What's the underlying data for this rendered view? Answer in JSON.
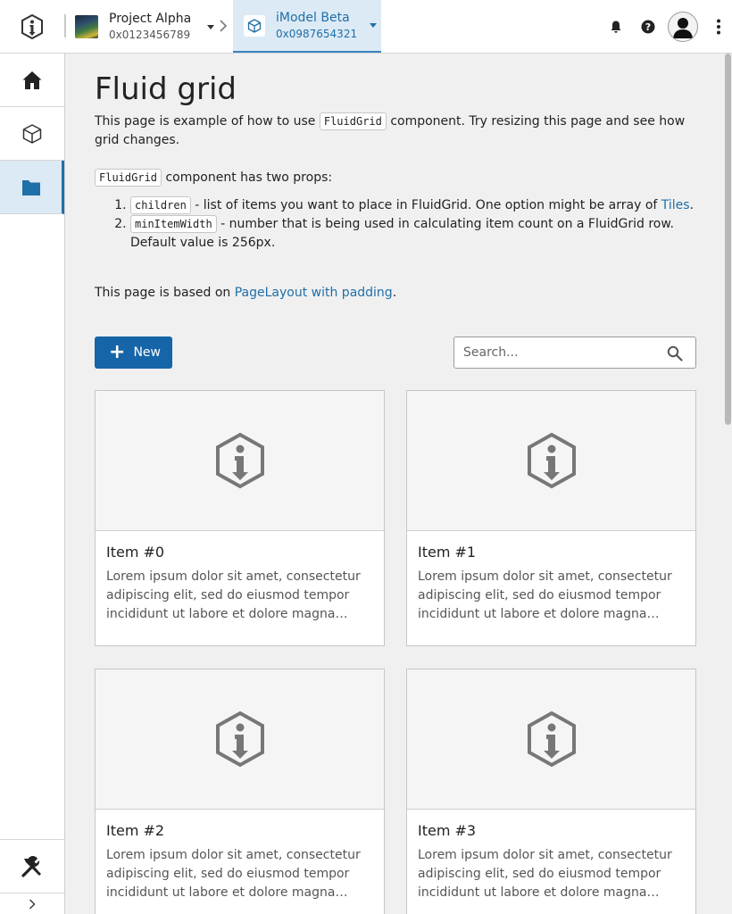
{
  "header": {
    "project": {
      "title": "Project Alpha",
      "id": "0x0123456789"
    },
    "imodel": {
      "title": "iModel Beta",
      "id": "0x0987654321"
    },
    "icons": [
      "app-logo-icon",
      "bell-icon",
      "help-icon",
      "user-avatar-icon",
      "more-vertical-icon"
    ]
  },
  "sidebar": {
    "items": [
      {
        "name": "home",
        "icon": "home-icon"
      },
      {
        "name": "imodel",
        "icon": "cube-icon"
      },
      {
        "name": "folder",
        "icon": "folder-icon",
        "active": true
      }
    ],
    "bottom": {
      "name": "tools",
      "icon": "tools-icon"
    }
  },
  "page": {
    "title": "Fluid grid",
    "intro_prefix": "This page is example of how to use",
    "intro_code": "FluidGrid",
    "intro_suffix": "component. Try resizing this page and see how grid changes.",
    "props_code": "FluidGrid",
    "props_text": "component has two props:",
    "prop1_code": "children",
    "prop1_text": "- list of items you want to place in FluidGrid. One option might be array of",
    "prop1_link": "Tiles",
    "prop1_end": ".",
    "prop2_code": "minItemWidth",
    "prop2_text": "- number that is being used in calculating item count on a FluidGrid row. Default value is 256px.",
    "based_prefix": "This page is based on",
    "based_link": "PageLayout with padding",
    "based_end": "."
  },
  "toolbar": {
    "new_label": "New",
    "search_placeholder": "Search..."
  },
  "tiles": [
    {
      "name": "Item #0",
      "description": "Lorem ipsum dolor sit amet, consectetur adipiscing elit, sed do eiusmod tempor incididunt ut labore et dolore magna aliqua."
    },
    {
      "name": "Item #1",
      "description": "Lorem ipsum dolor sit amet, consectetur adipiscing elit, sed do eiusmod tempor incididunt ut labore et dolore magna aliqua."
    },
    {
      "name": "Item #2",
      "description": "Lorem ipsum dolor sit amet, consectetur adipiscing elit, sed do eiusmod tempor incididunt ut labore et dolore magna aliqua."
    },
    {
      "name": "Item #3",
      "description": "Lorem ipsum dolor sit amet, consectetur adipiscing elit, sed do eiusmod tempor incididunt ut labore et dolore magna aliqua."
    }
  ],
  "colors": {
    "accent": "#1565a8",
    "active_bg": "#dceaf5",
    "link": "#1f6fa8"
  }
}
